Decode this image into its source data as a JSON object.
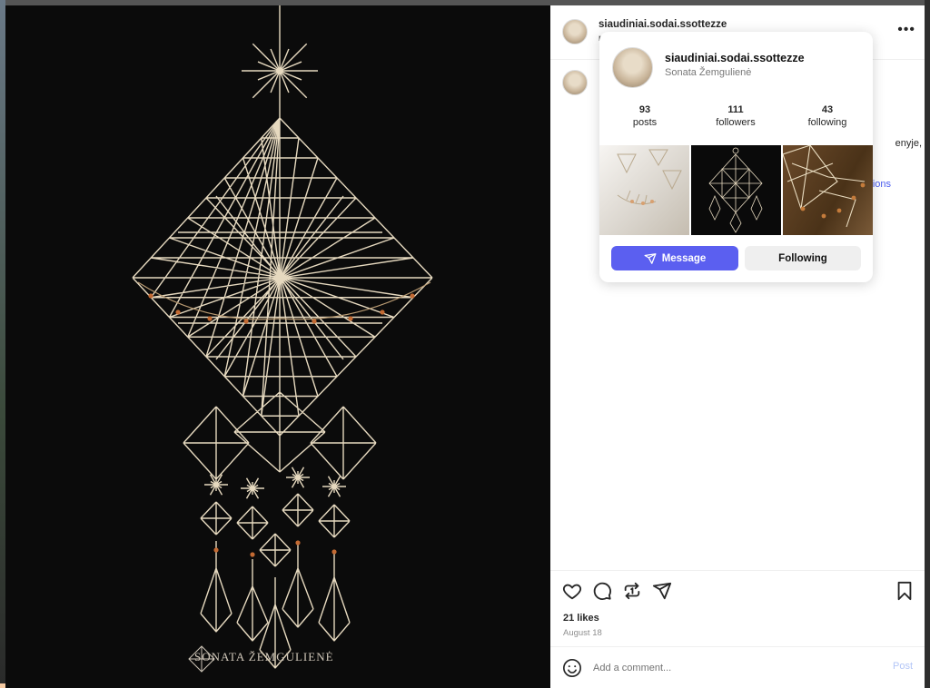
{
  "post": {
    "username": "siaudiniai.sodai.ssottezze",
    "subline": "r",
    "caption_fragment": "enyje,",
    "translation_fragment": "ions"
  },
  "hovercard": {
    "username": "siaudiniai.sodai.ssottezze",
    "full_name": "Sonata Žemgulienė",
    "stats": [
      {
        "value": "93",
        "label": "posts"
      },
      {
        "value": "111",
        "label": "followers"
      },
      {
        "value": "43",
        "label": "following"
      }
    ],
    "message_label": "Message",
    "following_label": "Following"
  },
  "actions": {
    "likes": "21 likes",
    "date": "August 18"
  },
  "comment": {
    "placeholder": "Add a comment...",
    "post_label": "Post"
  },
  "media": {
    "signature": "SONATA   ŽEMGULIENĖ"
  },
  "icons": {
    "more": "more-horizontal-icon",
    "like": "heart-icon",
    "comment": "comment-icon",
    "repost": "repost-icon",
    "share": "send-icon",
    "save": "bookmark-icon",
    "emoji": "emoji-icon"
  },
  "colors": {
    "accent": "#5b5ff0",
    "link": "#4a5cf0",
    "media_bg": "#0b0b0b",
    "straw": "#e6d9bf"
  }
}
